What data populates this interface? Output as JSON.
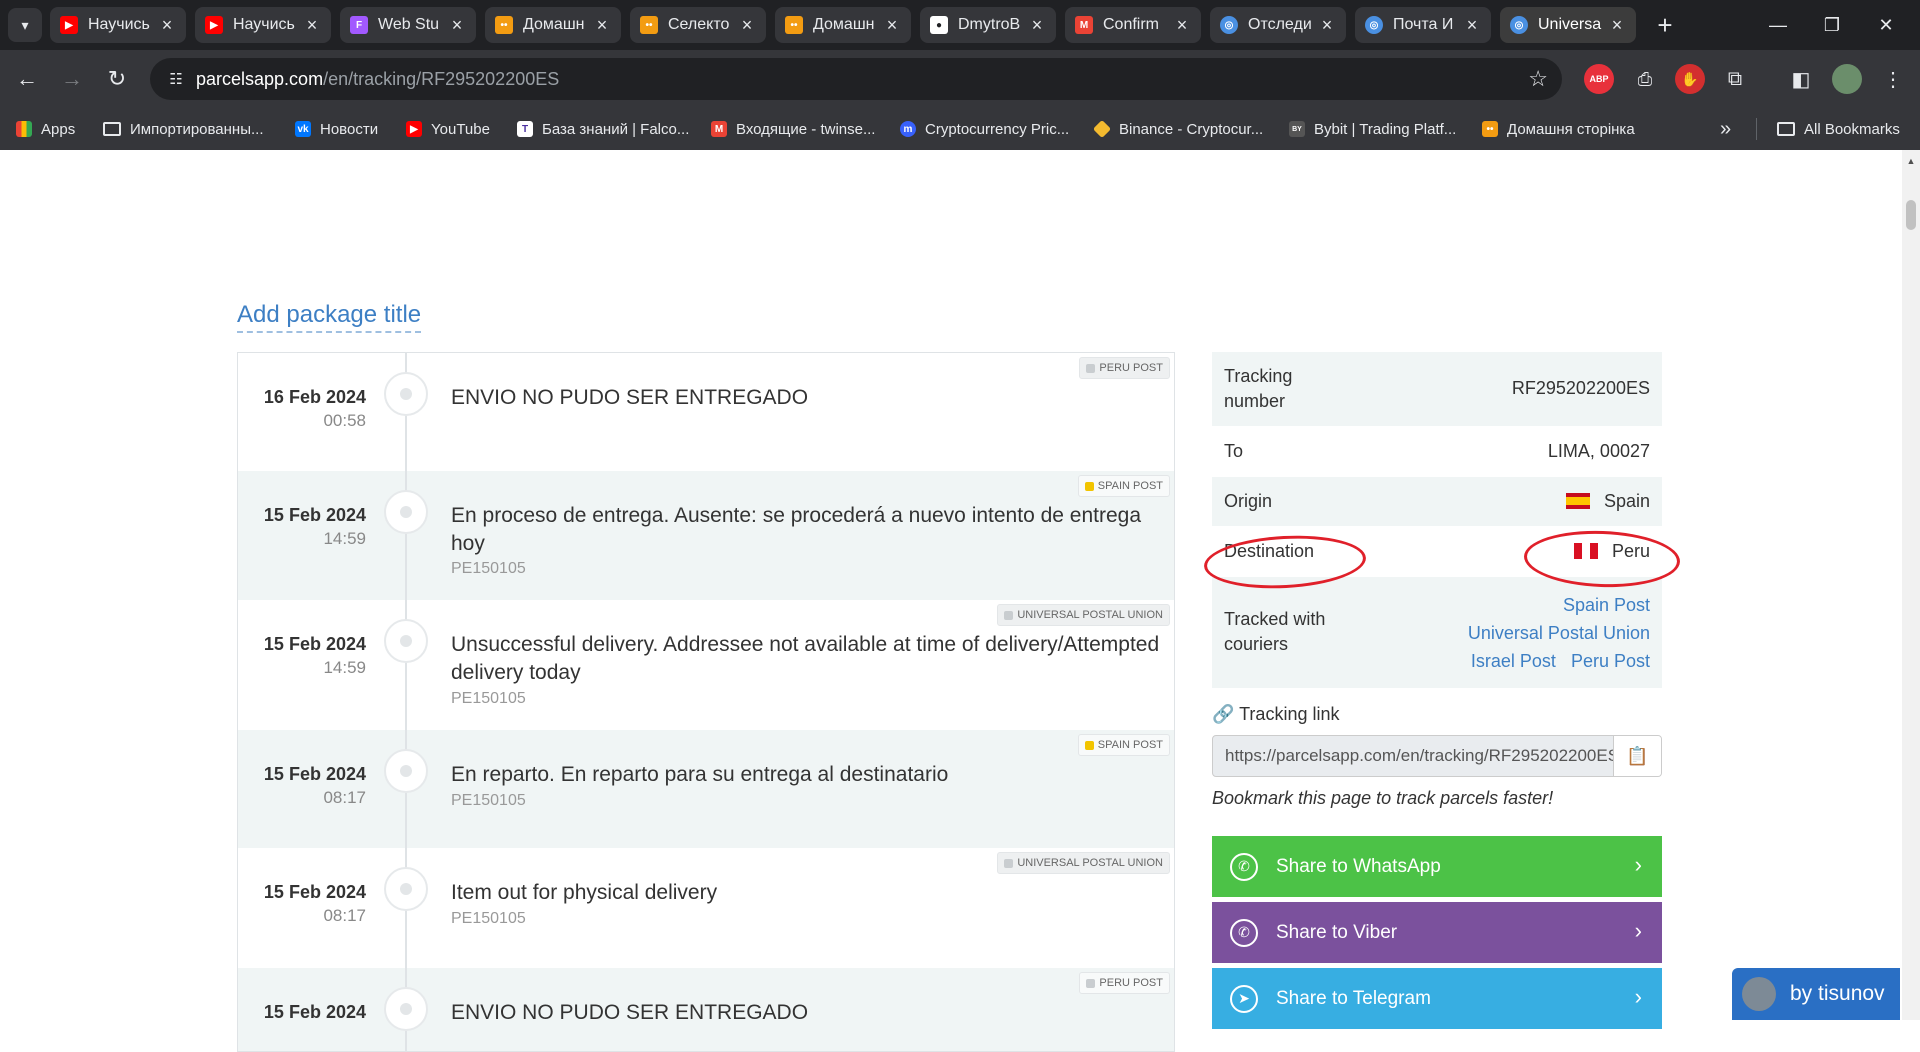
{
  "browser": {
    "tabs": [
      {
        "title": "Научись",
        "favicon": "youtube-icon",
        "color": "#ff0000",
        "active": false
      },
      {
        "title": "Научись",
        "favicon": "youtube-icon",
        "color": "#ff0000",
        "active": false
      },
      {
        "title": "Web Stu",
        "favicon": "figma-icon",
        "color": "#a259ff",
        "active": false
      },
      {
        "title": "Домашн",
        "favicon": "site-icon",
        "color": "#f39c12",
        "active": false
      },
      {
        "title": "Селекто",
        "favicon": "site-icon",
        "color": "#f39c12",
        "active": false
      },
      {
        "title": "Домашн",
        "favicon": "site-icon",
        "color": "#f39c12",
        "active": false
      },
      {
        "title": "DmytroB",
        "favicon": "github-icon",
        "color": "#ffffff",
        "active": false
      },
      {
        "title": "Confirm",
        "favicon": "gmail-icon",
        "color": "#ea4335",
        "active": false
      },
      {
        "title": "Отследи",
        "favicon": "parcelsapp-icon",
        "color": "#4a90e2",
        "active": false
      },
      {
        "title": "Почта И",
        "favicon": "parcelsapp-icon",
        "color": "#4a90e2",
        "active": false
      },
      {
        "title": "Universa",
        "favicon": "parcelsapp-icon",
        "color": "#4a90e2",
        "active": true
      }
    ],
    "url_host": "parcelsapp.com",
    "url_path": "/en/tracking/RF295202200ES",
    "bookmarks": [
      {
        "label": "Apps",
        "icon": "apps-grid-icon",
        "color": "#ea4335"
      },
      {
        "label": "Импортированны...",
        "icon": "folder-icon",
        "color": "#35363a"
      },
      {
        "label": "Новости",
        "icon": "vk-icon",
        "color": "#0077ff"
      },
      {
        "label": "YouTube",
        "icon": "youtube-icon",
        "color": "#ff0000"
      },
      {
        "label": "База знаний | Falco...",
        "icon": "t-icon",
        "color": "#ffffff"
      },
      {
        "label": "Входящие - twinse...",
        "icon": "gmail-icon",
        "color": "#ea4335"
      },
      {
        "label": "Cryptocurrency Pric...",
        "icon": "coinmarketcap-icon",
        "color": "#3861fb"
      },
      {
        "label": "Binance - Cryptocur...",
        "icon": "binance-icon",
        "color": "#f3ba2f"
      },
      {
        "label": "Bybit | Trading Platf...",
        "icon": "bybit-icon",
        "color": "#555555"
      },
      {
        "label": "Домашня сторінка",
        "icon": "site-icon",
        "color": "#f39c12"
      }
    ],
    "all_bookmarks": "All Bookmarks"
  },
  "page": {
    "package_title": "Add package title",
    "events": [
      {
        "date": "16 Feb 2024",
        "time": "00:58",
        "message": "ENVIO NO PUDO SER ENTREGADO",
        "location": "",
        "courier": "PERU POST"
      },
      {
        "date": "15 Feb 2024",
        "time": "14:59",
        "message": "En proceso de entrega. Ausente: se procederá a nuevo intento de entrega hoy",
        "location": "PE150105",
        "courier": "SPAIN POST"
      },
      {
        "date": "15 Feb 2024",
        "time": "14:59",
        "message": "Unsuccessful delivery. Addressee not available at time of delivery/Attempted delivery today",
        "location": "PE150105",
        "courier": "UNIVERSAL POSTAL UNION"
      },
      {
        "date": "15 Feb 2024",
        "time": "08:17",
        "message": "En reparto. En reparto para su entrega al destinatario",
        "location": "PE150105",
        "courier": "SPAIN POST"
      },
      {
        "date": "15 Feb 2024",
        "time": "08:17",
        "message": "Item out for physical delivery",
        "location": "PE150105",
        "courier": "UNIVERSAL POSTAL UNION"
      },
      {
        "date": "15 Feb 2024",
        "time": "",
        "message": "ENVIO NO PUDO SER ENTREGADO",
        "location": "",
        "courier": "PERU POST"
      }
    ],
    "info": {
      "tracking_label": "Tracking number",
      "tracking_value": "RF295202200ES",
      "to_label": "To",
      "to_value": "LIMA, 00027",
      "origin_label": "Origin",
      "origin_value": "Spain",
      "destination_label": "Destination",
      "destination_value": "Peru",
      "couriers_label": "Tracked with couriers",
      "couriers": [
        "Spain Post",
        "Universal Postal Union",
        "Israel Post",
        "Peru Post"
      ]
    },
    "tracking_link_label": "Tracking link",
    "tracking_link_value": "https://parcelsapp.com/en/tracking/RF295202200ES",
    "bookmark_note": "Bookmark this page to track parcels faster!",
    "share": {
      "whatsapp": "Share to WhatsApp",
      "viber": "Share to Viber",
      "telegram": "Share to Telegram"
    },
    "byline": "by tisunov"
  },
  "colors": {
    "link": "#3d7fc4",
    "whatsapp": "#4cc247",
    "viber": "#7b519d",
    "telegram": "#37aee2",
    "annotation": "#e0202a"
  }
}
